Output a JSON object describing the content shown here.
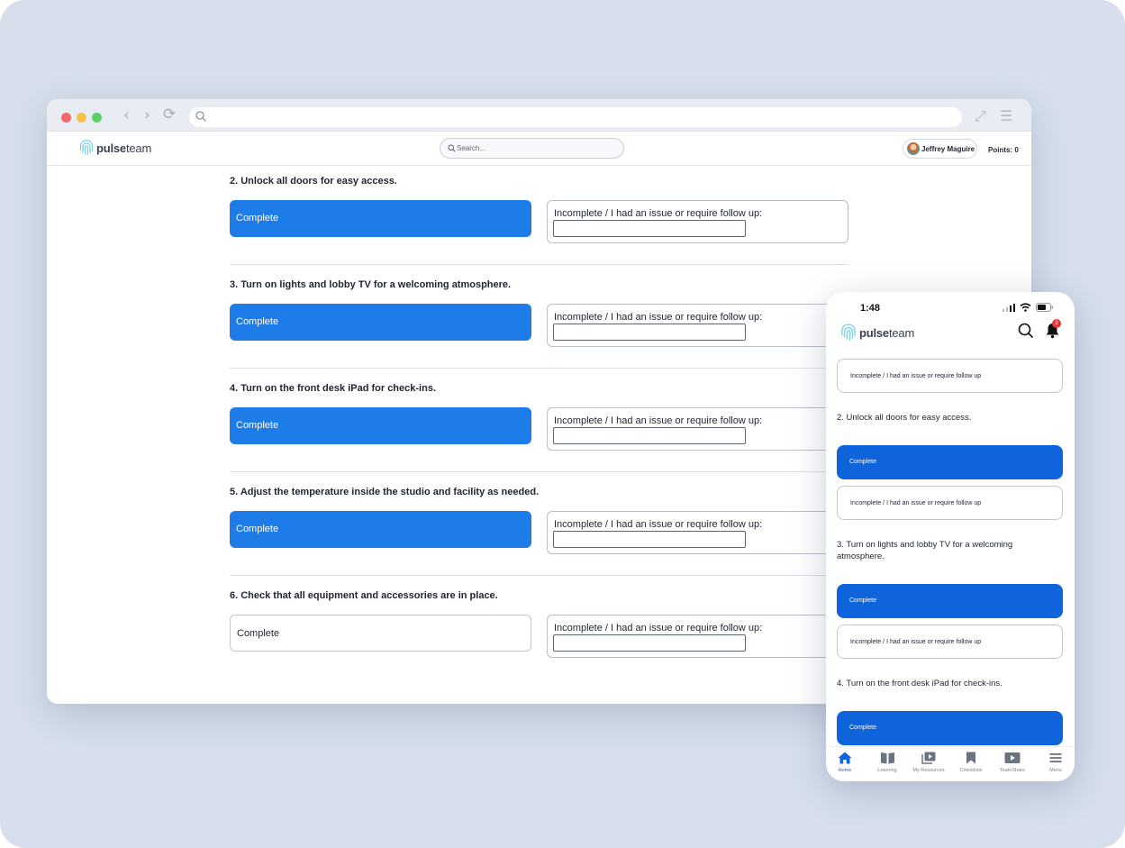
{
  "browser": {
    "app_name_bold": "pulse",
    "app_name_rest": "team",
    "search_placeholder": "Search...",
    "user_name": "Jeffrey Maguire",
    "points_label": "Points: 0"
  },
  "checklist": {
    "items": [
      {
        "title": "2. Unlock all doors for easy access.",
        "complete_label": "Complete",
        "complete_selected": true,
        "incomplete_label": "Incomplete / I had an issue or require follow up:"
      },
      {
        "title": "3. Turn on lights and lobby TV for a welcoming atmosphere.",
        "complete_label": "Complete",
        "complete_selected": true,
        "incomplete_label": "Incomplete / I had an issue or require follow up:"
      },
      {
        "title": "4. Turn on the front desk iPad for check-ins.",
        "complete_label": "Complete",
        "complete_selected": true,
        "incomplete_label": "Incomplete / I had an issue or require follow up:"
      },
      {
        "title": "5. Adjust the temperature inside the studio and facility as needed.",
        "complete_label": "Complete",
        "complete_selected": true,
        "incomplete_label": "Incomplete / I had an issue or require follow up:"
      },
      {
        "title": "6. Check that all equipment and accessories are in place.",
        "complete_label": "Complete",
        "complete_selected": false,
        "incomplete_label": "Incomplete / I had an issue or require follow up:"
      }
    ]
  },
  "phone": {
    "time": "1:48",
    "app_name_bold": "pulse",
    "app_name_rest": "team",
    "notification_count": "2",
    "incomplete_label": "Incomplete / I had an issue or require follow up",
    "complete_label": "Complete",
    "items": [
      "2. Unlock all doors for easy access.",
      "3. Turn on lights and lobby TV for a welcoming atmosphere.",
      "4. Turn on the front desk iPad for check-ins."
    ],
    "tabs": [
      {
        "label": "Home",
        "icon": "home-icon",
        "active": true
      },
      {
        "label": "Learning",
        "icon": "book-icon",
        "active": false
      },
      {
        "label": "My Resources",
        "icon": "resources-icon",
        "active": false
      },
      {
        "label": "Checklists",
        "icon": "bookmark-icon",
        "active": false
      },
      {
        "label": "TeamShare",
        "icon": "video-icon",
        "active": false
      },
      {
        "label": "Menu",
        "icon": "menu-icon",
        "active": false
      }
    ]
  },
  "colors": {
    "primary": "#1e7ce8",
    "phone_primary": "#0f64dc",
    "backdrop": "#d6dfeb"
  }
}
